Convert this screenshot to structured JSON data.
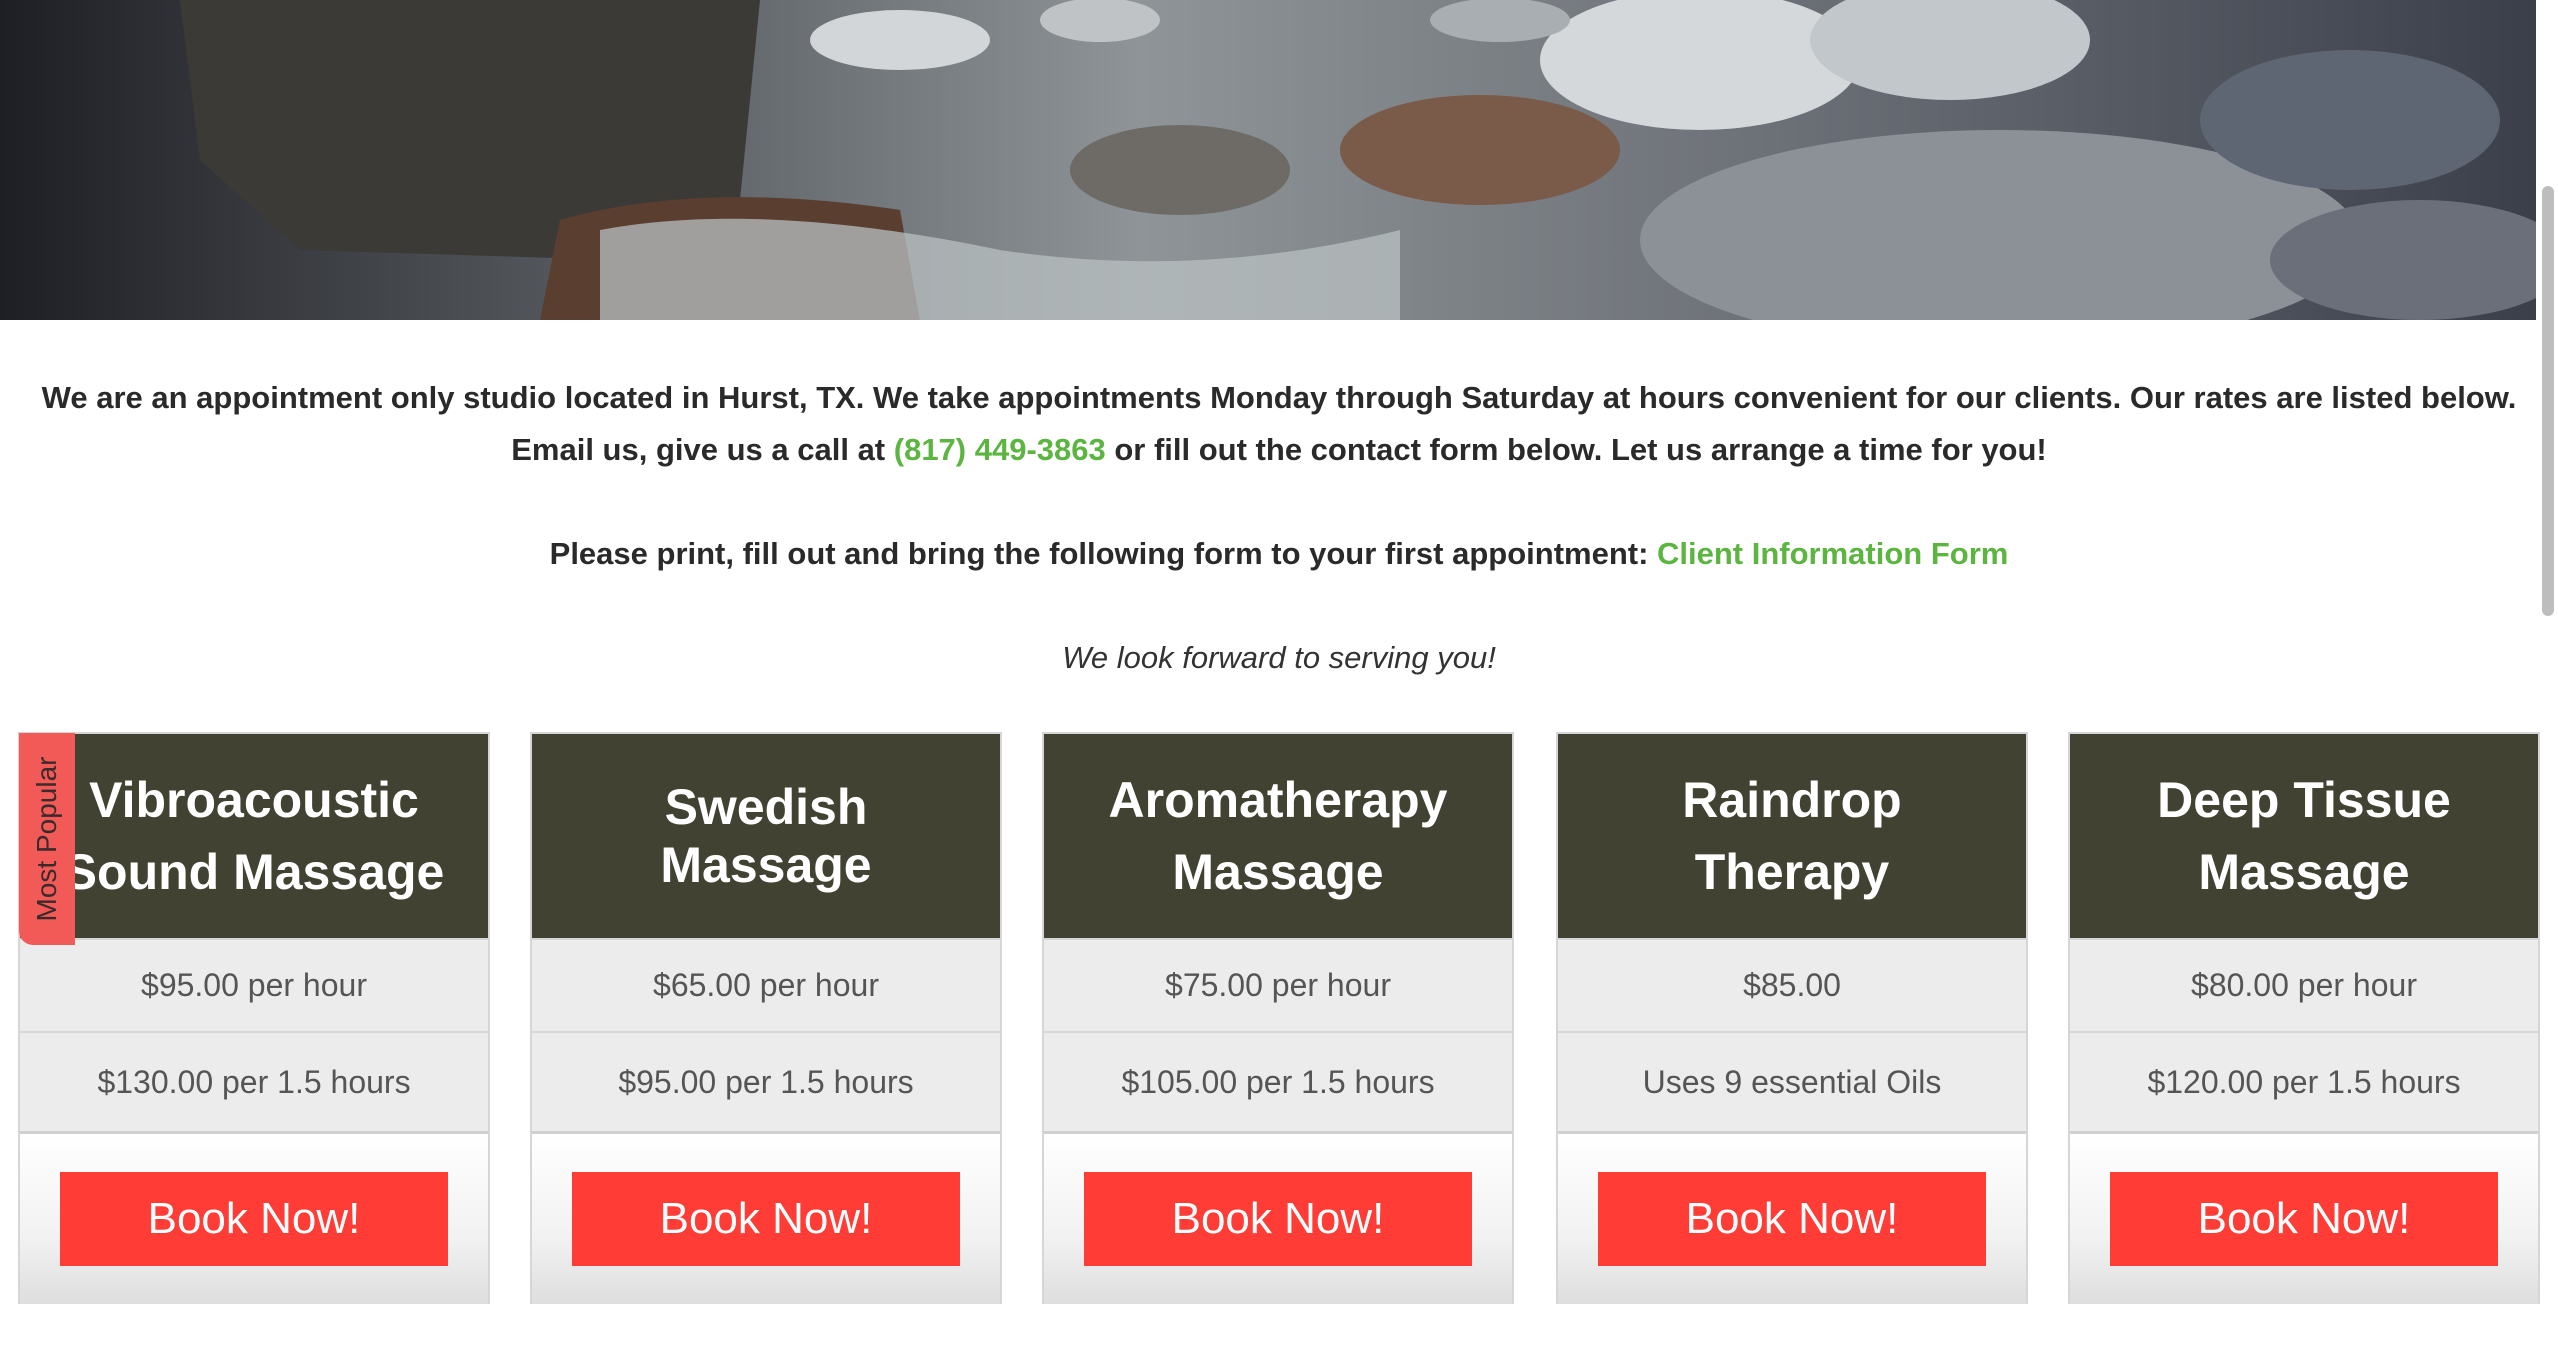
{
  "hero": {
    "image_name": "rocky-stream-banner"
  },
  "intro": {
    "line1": "We are an appointment only studio located in Hurst, TX. We take appointments Monday through Saturday at hours convenient for our clients. Our rates are listed below.",
    "line2_prefix": "Email us, give us a call at ",
    "phone": "(817) 449-3863",
    "line2_suffix": "  or fill out the contact form below. Let us arrange a time for you!",
    "form_prefix": "Please print, fill out and bring the following form to your first appointment: ",
    "form_link": "Client Information Form",
    "closing": "We look forward to serving you!"
  },
  "colors": {
    "accent_green": "#5cb540",
    "card_header": "#424232",
    "book_button": "#ff3c35",
    "ribbon": "#f25a58"
  },
  "cards": [
    {
      "title": "Vibroacoustic Sound Massage",
      "row1": "$95.00 per hour",
      "row2": "$130.00 per 1.5 hours",
      "button": "Book Now!",
      "ribbon": "Most Popular"
    },
    {
      "title": "Swedish Massage",
      "row1": "$65.00 per hour",
      "row2": "$95.00 per 1.5 hours",
      "button": "Book Now!"
    },
    {
      "title": "Aromatherapy Massage",
      "row1": "$75.00 per hour",
      "row2": "$105.00 per 1.5 hours",
      "button": "Book Now!"
    },
    {
      "title": "Raindrop Therapy",
      "row1": "$85.00",
      "row2": "Uses 9 essential Oils",
      "button": "Book Now!"
    },
    {
      "title": "Deep Tissue Massage",
      "row1": "$80.00 per hour",
      "row2": "$120.00 per 1.5 hours",
      "button": "Book Now!"
    }
  ]
}
